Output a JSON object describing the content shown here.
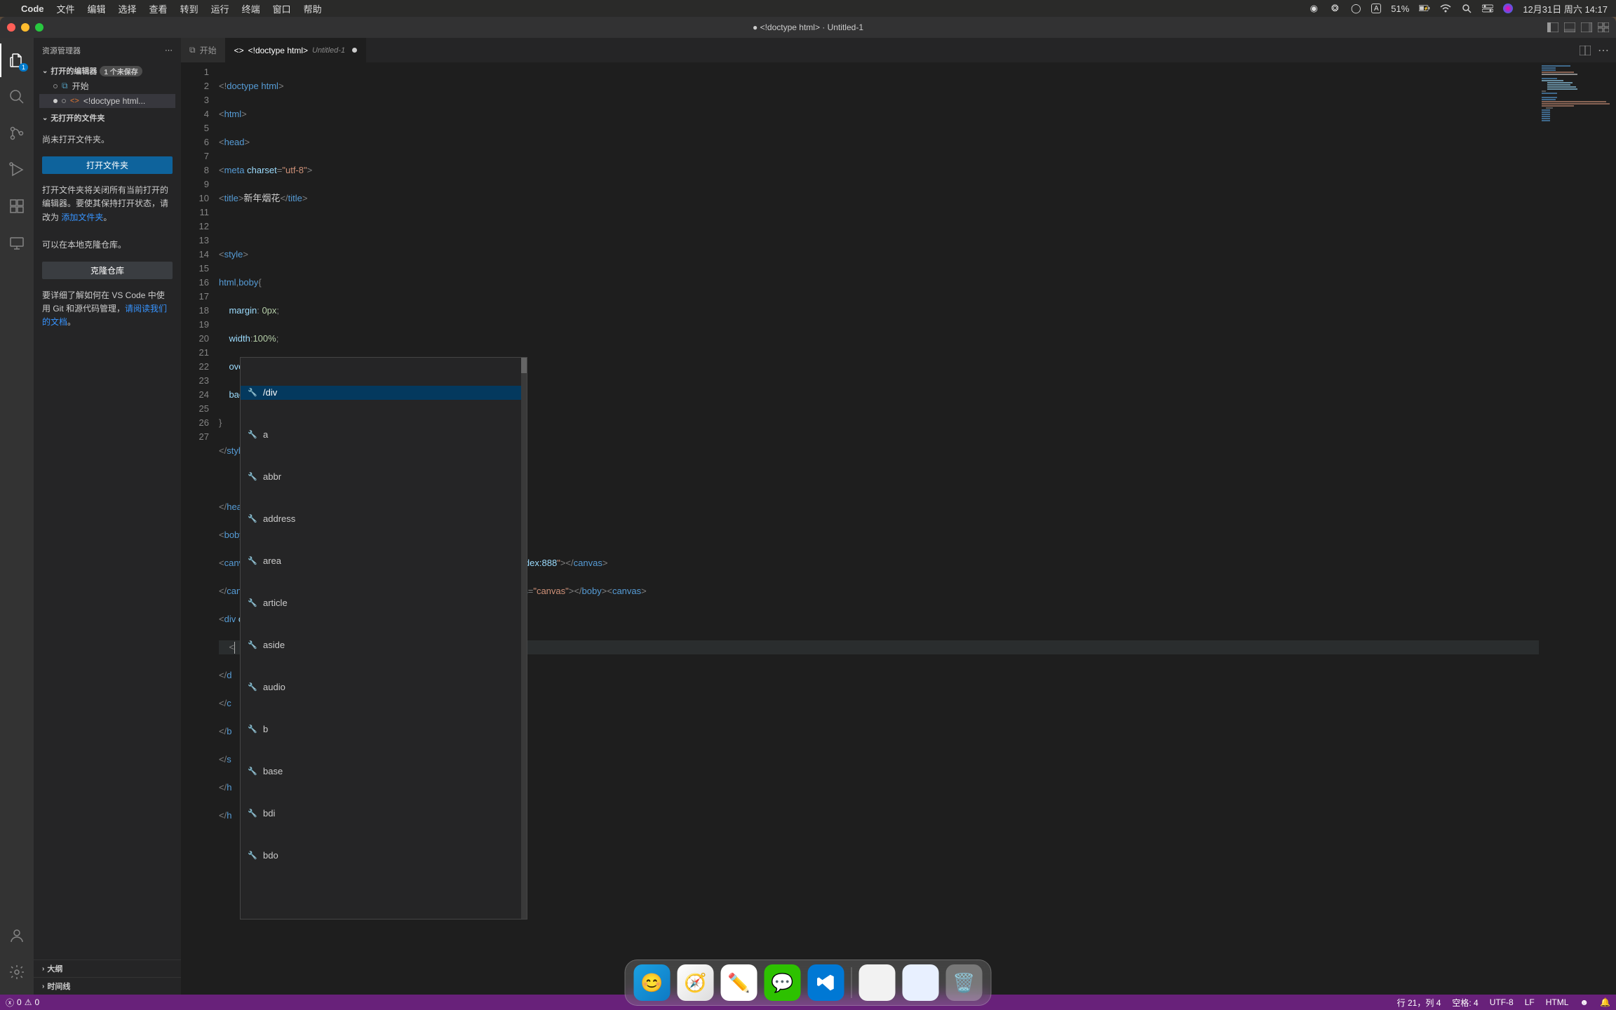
{
  "menubar": {
    "app": "Code",
    "items": [
      "文件",
      "编辑",
      "选择",
      "查看",
      "转到",
      "运行",
      "终端",
      "窗口",
      "帮助"
    ],
    "battery": "51%",
    "battery_icon": "⚡",
    "datetime": "12月31日 周六 14:17"
  },
  "window": {
    "title": "● <!doctype html> · Untitled-1"
  },
  "sidebar": {
    "title": "资源管理器",
    "open_editors": {
      "label": "打开的编辑器",
      "badge": "1 个未保存",
      "items": [
        {
          "label": "开始",
          "icon": "vs",
          "modified": false
        },
        {
          "label": "<!doctype html...",
          "icon": "html",
          "modified": true
        }
      ]
    },
    "no_folder": {
      "label": "无打开的文件夹",
      "msg1": "尚未打开文件夹。",
      "btn_open": "打开文件夹",
      "msg2_a": "打开文件夹将关闭所有当前打开的编辑器。要使其保持打开状态，请改为 ",
      "msg2_link": "添加文件夹",
      "msg2_b": "。",
      "msg3": "可以在本地克隆仓库。",
      "btn_clone": "克隆仓库",
      "msg4_a": "要详细了解如何在 VS Code 中使用 Git 和源代码管理，",
      "msg4_link": "请阅读我们的文档",
      "msg4_b": "。"
    },
    "outline": "大纲",
    "timeline": "时间线"
  },
  "tabs": [
    {
      "icon": "vs",
      "label": "开始",
      "active": false,
      "modified": false
    },
    {
      "icon": "html",
      "label": "<!doctype html>",
      "sub": "Untitled-1",
      "active": true,
      "modified": true
    }
  ],
  "code": {
    "lines": 27,
    "content": [
      "<!doctype html>",
      "<html>",
      "<head>",
      "<meta charset=\"utf-8\">",
      "<title>新年烟花</title>",
      "",
      "<style>",
      "html,boby{",
      "    margin: 0px;",
      "    width:100%;",
      "    overflow:hidden;",
      "    background:□#000;",
      "}",
      "</style>",
      "",
      "</head>",
      "<boby>",
      "<canvas id=\"'canvas'style=\"position:absoluute;width:100%;height:100%;z-index:888\"></canvas>",
      "</canvas style=\"position:absolute;width100%;heiht:1oo%;z-index:9999\"class=\"canvas\"></boby><canvas>",
      "<div class=\"overlay\">",
      "    <",
      "</d",
      "</c",
      "</b",
      "</s",
      "</h",
      "</h"
    ]
  },
  "suggest": {
    "items": [
      "/div",
      "a",
      "abbr",
      "address",
      "area",
      "article",
      "aside",
      "audio",
      "b",
      "base",
      "bdi",
      "bdo"
    ],
    "selected": 0
  },
  "statusbar": {
    "errors": "0",
    "warnings": "0",
    "cursor": "行 21，列 4",
    "spaces": "空格: 4",
    "encoding": "UTF-8",
    "eol": "LF",
    "lang": "HTML"
  }
}
